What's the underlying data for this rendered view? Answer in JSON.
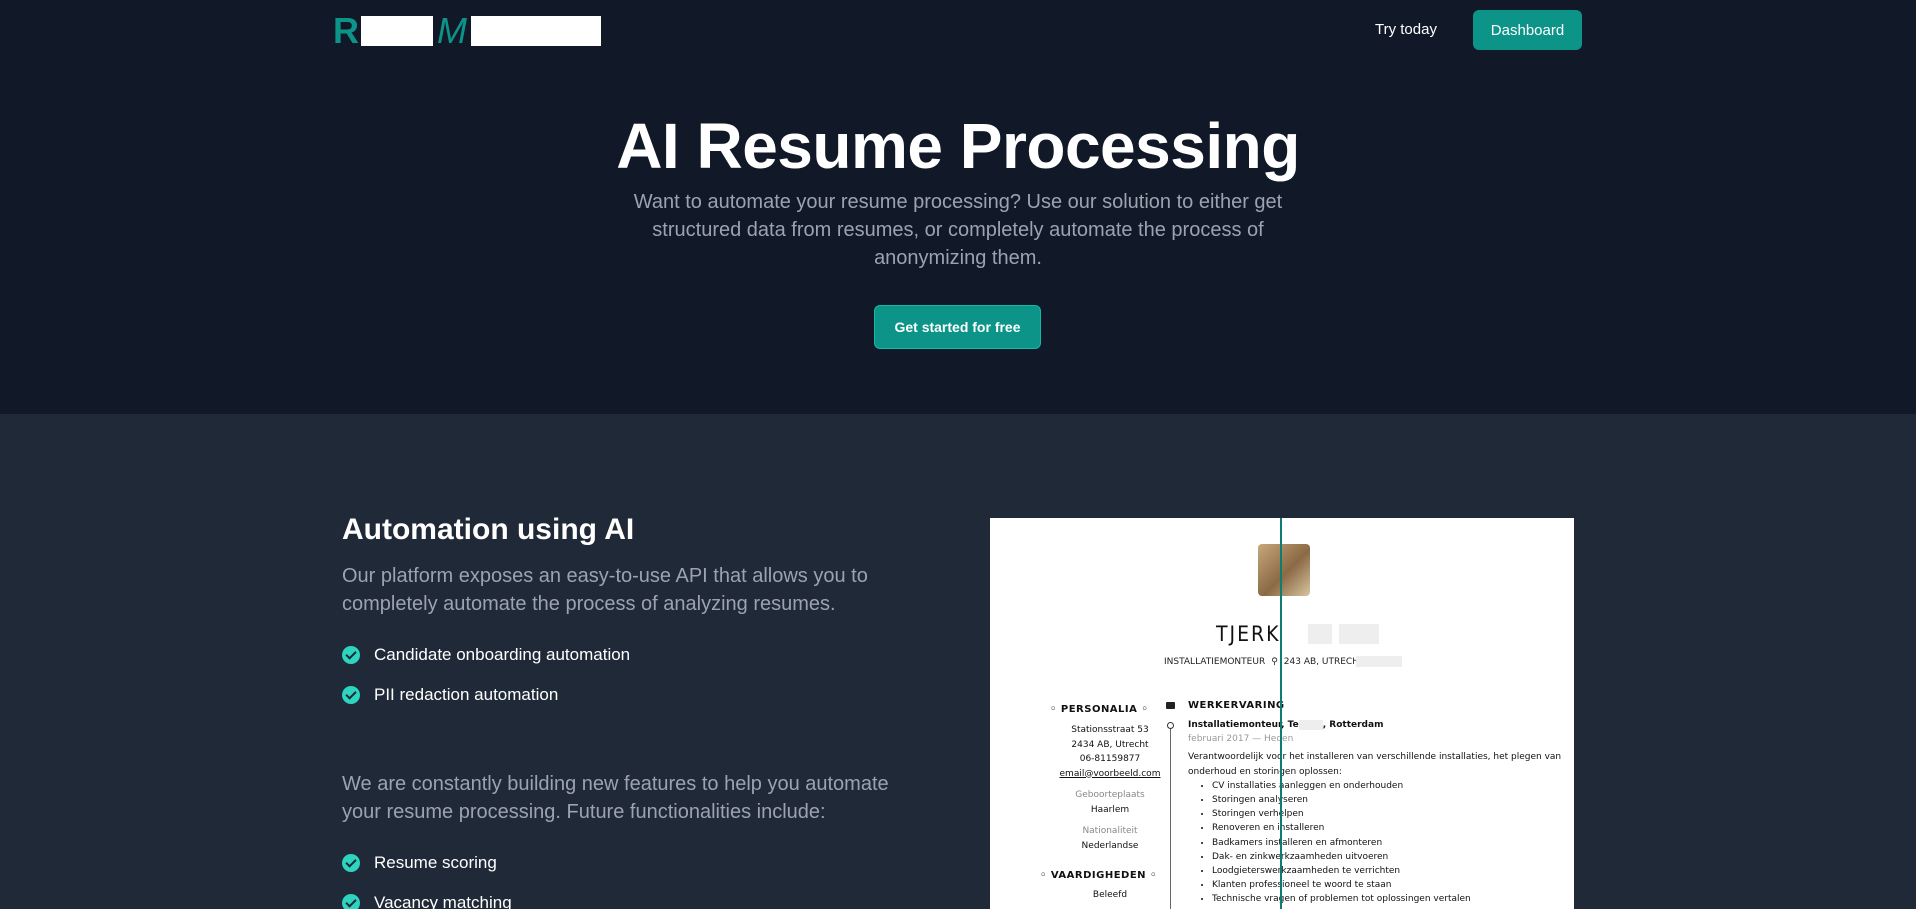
{
  "header": {
    "logo_letter_1": "R",
    "logo_letter_2": "M",
    "try_label": "Try today",
    "dashboard_label": "Dashboard"
  },
  "hero": {
    "title": "AI Resume Processing",
    "subtitle": "Want to automate your resume processing? Use our solution to either get structured data from resumes, or completely automate the process of anonymizing them.",
    "cta_label": "Get started for free"
  },
  "feature": {
    "title": "Automation using AI",
    "description": "Our platform exposes an easy-to-use API that allows you to completely automate the process of analyzing resumes.",
    "current_features": [
      "Candidate onboarding automation",
      "PII redaction automation"
    ],
    "future_description": "We are constantly building new features to help you automate your resume processing. Future functionalities include:",
    "future_features": [
      "Resume scoring",
      "Vacancy matching"
    ]
  },
  "resume": {
    "name": "TJERK",
    "job": "INSTALLATIEMONTEUR",
    "location": "243  AB, UTRECHT",
    "personal_heading": "PERSONALIA",
    "address_line1": "Stationsstraat 53",
    "address_line2": "2434 AB, Utrecht",
    "phone": "06-81159877",
    "email": "email@voorbeeld.com",
    "birthplace_label": "Geboorteplaats",
    "birthplace": "Haarlem",
    "nationality_label": "Nationaliteit",
    "nationality": "Nederlandse",
    "skills_heading": "VAARDIGHEDEN",
    "skill_1": "Beleefd",
    "work_heading": "WERKERVARING",
    "job_title_prefix": "Installatiemonteur, Te",
    "job_title_suffix": ", Rotterdam",
    "job_dates": "februari 2017 — Heden",
    "job_summary": "Verantwoordelijk voor het installeren van verschillende installaties, het plegen van onderhoud en storingen oplossen:",
    "duties": [
      "CV installaties aanleggen en onderhouden",
      "Storingen analyseren",
      "Storingen verhelpen",
      "Renoveren en installeren",
      "Badkamers installeren en afmonteren",
      "Dak- en zinkwerkzaamheden uitvoeren",
      "Loodgieterswerkzaamheden te verrichten",
      "Klanten professioneel te woord te staan",
      "Technische vragen of problemen tot oplossingen vertalen"
    ]
  },
  "colors": {
    "accent": "#0d9488",
    "check": "#2dd4bf",
    "hero_bg": "#111827",
    "section_bg": "#1f2937"
  }
}
